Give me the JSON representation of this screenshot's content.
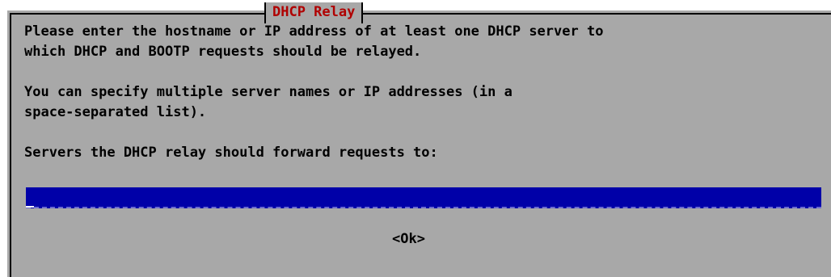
{
  "dialog": {
    "title": "DHCP Relay",
    "description_lines": [
      "Please enter the hostname or IP address of at least one DHCP server to",
      "which DHCP and BOOTP requests should be relayed."
    ],
    "hint_lines": [
      "You can specify multiple server names or IP addresses (in a",
      "space-separated list)."
    ],
    "prompt": "Servers the DHCP relay should forward requests to:",
    "input_value": "",
    "ok_label": "<Ok>"
  },
  "colors": {
    "dialog_background": "#a8a8a8",
    "title_text": "#b00000",
    "input_background": "#0000a8"
  }
}
